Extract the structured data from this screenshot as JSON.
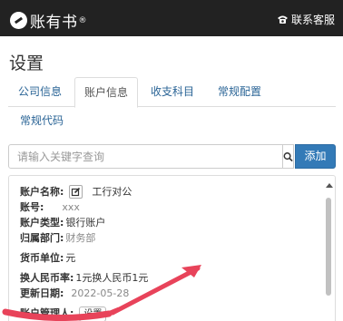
{
  "header": {
    "app_name": "账有书",
    "reg_mark": "®",
    "service_label": "联系客服",
    "service_icon": "phone-icon"
  },
  "page": {
    "title": "设置"
  },
  "tabs": [
    {
      "label": "公司信息",
      "active": false
    },
    {
      "label": "账户信息",
      "active": true
    },
    {
      "label": "收支科目",
      "active": false
    },
    {
      "label": "常规配置",
      "active": false
    },
    {
      "label": "常规代码",
      "active": false
    }
  ],
  "search": {
    "placeholder": "请输入关键字查询",
    "value": "",
    "add_label": "添加"
  },
  "account": {
    "name_label": "账户名称:",
    "name_value": "工行对公",
    "number_label": "账号:",
    "number_value": "xxx",
    "type_label": "账户类型:",
    "type_value": "银行账户",
    "dept_label": "归属部门:",
    "dept_value": "财务部",
    "currency_label": "货币单位:",
    "currency_value": "元",
    "rate_label": "换人民币率:",
    "rate_value": "1元换人民币1元",
    "updated_label": "更新日期:",
    "updated_value": "2022-05-28",
    "manager_label": "账户管理人:",
    "manager_button": "设置"
  },
  "colors": {
    "header_bg": "#222222",
    "link": "#2a6496",
    "primary": "#337ab7",
    "annotation": "#e8435a"
  }
}
